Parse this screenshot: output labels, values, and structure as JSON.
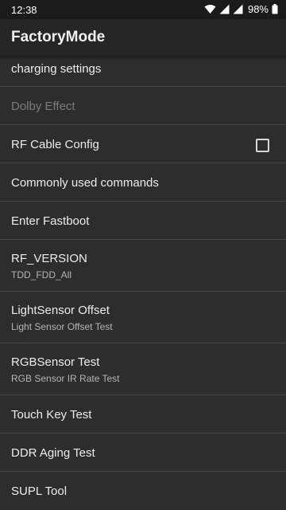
{
  "status": {
    "time": "12:38",
    "battery": "98%"
  },
  "app_bar": {
    "title": "FactoryMode"
  },
  "items": [
    {
      "title": "charging settings"
    },
    {
      "title": "Dolby Effect",
      "disabled": true
    },
    {
      "title": "RF Cable Config",
      "checkbox": false
    },
    {
      "title": "Commonly used commands"
    },
    {
      "title": "Enter Fastboot"
    },
    {
      "title": "RF_VERSION",
      "subtitle": "TDD_FDD_All"
    },
    {
      "title": "LightSensor Offset",
      "subtitle": "Light Sensor Offset Test"
    },
    {
      "title": "RGBSensor Test",
      "subtitle": "RGB Sensor IR Rate Test"
    },
    {
      "title": "Touch Key Test"
    },
    {
      "title": "DDR Aging Test"
    },
    {
      "title": "SUPL Tool"
    }
  ]
}
